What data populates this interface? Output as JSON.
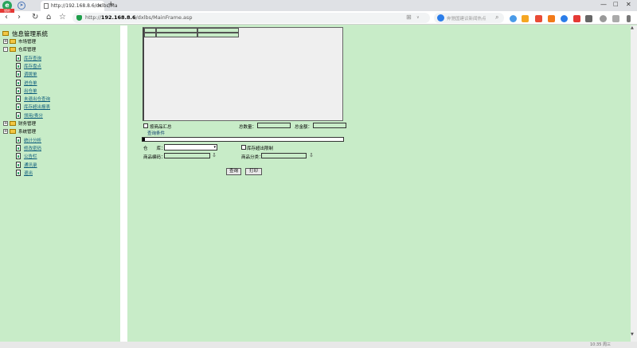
{
  "browser": {
    "logo_glyph": "e",
    "logo_badge": "猎豹",
    "tab_title": "http://192.168.8.6/dxlbs/Ma",
    "tab_close": "×",
    "new_tab": "+",
    "url_prefix": "http://",
    "url_host": "192.168.8.6",
    "url_path": "/dxlbs/MainFrame.asp",
    "addr_grid_glyph": "⊞",
    "addr_label": "∨",
    "search_placeholder": "奔驰国建议新闻热点",
    "win_min": "—",
    "win_max": "□",
    "win_close": "✕",
    "nav_back": "‹",
    "nav_forward": "›",
    "nav_reload": "↻",
    "nav_home": "⌂",
    "nav_star": "☆"
  },
  "tree": {
    "root": "信息管理系统",
    "nodes": [
      {
        "label": "市场管理",
        "type": "folder",
        "expander": "+"
      },
      {
        "label": "仓库管理",
        "type": "folder",
        "expander": "-"
      },
      {
        "label": "库存查询",
        "type": "link"
      },
      {
        "label": "库存盘点",
        "type": "link"
      },
      {
        "label": "调拨单",
        "type": "link"
      },
      {
        "label": "进仓单",
        "type": "link"
      },
      {
        "label": "出仓单",
        "type": "link"
      },
      {
        "label": "未退出仓查询",
        "type": "link"
      },
      {
        "label": "库存超出报表",
        "type": "link"
      },
      {
        "label": "领用/责分",
        "type": "link"
      },
      {
        "label": "财务管理",
        "type": "folder",
        "expander": "+"
      },
      {
        "label": "系统管理",
        "type": "folder",
        "expander": "+"
      },
      {
        "label": "统计分析",
        "type": "link"
      },
      {
        "label": "修改密码",
        "type": "link"
      },
      {
        "label": "公告栏",
        "type": "link"
      },
      {
        "label": "通讯录",
        "type": "link"
      },
      {
        "label": "退出",
        "type": "link"
      }
    ]
  },
  "form": {
    "summary_label": "按商品汇总",
    "total_qty_label": "总数量：",
    "total_amount_label": "总金额：",
    "query_conditions": "查询条件",
    "progress_fraction": 0.012,
    "warehouse_label": "仓　　库：",
    "warehouse_caret": "▾",
    "stock_limit_label": "库存超出限制",
    "product_code_label": "商品编码：",
    "product_category_label": "商品分类：",
    "download_icon": "⇩",
    "query_button": "查询",
    "print_button": "打印"
  },
  "scroll": {
    "up": "▲",
    "down": "▼"
  },
  "status": {
    "text": "10:35 周三"
  }
}
